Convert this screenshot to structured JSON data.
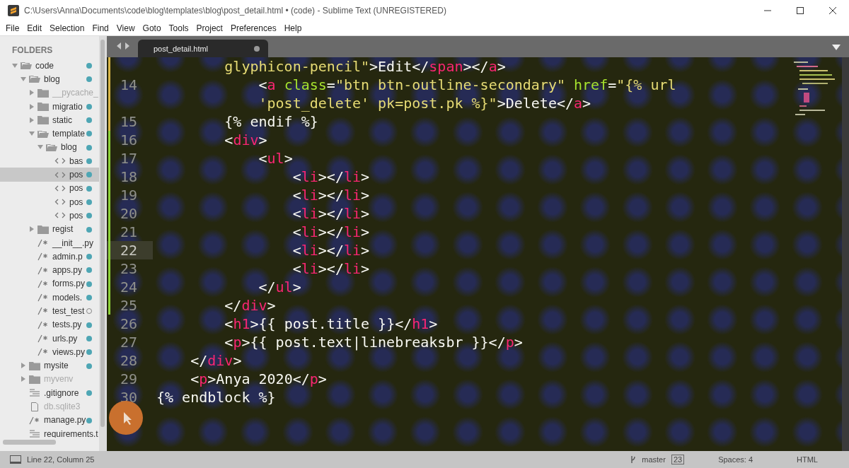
{
  "window": {
    "title": "C:\\Users\\Anna\\Documents\\code\\blog\\templates\\blog\\post_detail.html • (code) - Sublime Text (UNREGISTERED)"
  },
  "menu": [
    "File",
    "Edit",
    "Selection",
    "Find",
    "View",
    "Goto",
    "Tools",
    "Project",
    "Preferences",
    "Help"
  ],
  "sidebar": {
    "header": "FOLDERS",
    "tree": [
      {
        "name": "code",
        "kind": "folder",
        "expanded": true,
        "changed": true,
        "untracked": false,
        "ignored": false,
        "selected": false,
        "children": [
          {
            "name": "blog",
            "kind": "folder",
            "expanded": true,
            "changed": true,
            "untracked": false,
            "ignored": false,
            "selected": false,
            "children": [
              {
                "name": "__pycache_",
                "kind": "folder",
                "expanded": false,
                "changed": false,
                "untracked": false,
                "ignored": true,
                "selected": false
              },
              {
                "name": "migratio",
                "kind": "folder",
                "expanded": false,
                "changed": true,
                "untracked": false,
                "ignored": false,
                "selected": false
              },
              {
                "name": "static",
                "kind": "folder",
                "expanded": false,
                "changed": true,
                "untracked": false,
                "ignored": false,
                "selected": false
              },
              {
                "name": "template",
                "kind": "folder",
                "expanded": true,
                "changed": true,
                "untracked": false,
                "ignored": false,
                "selected": false,
                "children": [
                  {
                    "name": "blog",
                    "kind": "folder",
                    "expanded": true,
                    "changed": true,
                    "untracked": false,
                    "ignored": false,
                    "selected": false,
                    "children": [
                      {
                        "name": "bas",
                        "kind": "html",
                        "changed": true,
                        "untracked": false,
                        "ignored": false,
                        "selected": false
                      },
                      {
                        "name": "pos",
                        "kind": "html",
                        "changed": true,
                        "untracked": false,
                        "ignored": false,
                        "selected": true
                      },
                      {
                        "name": "pos",
                        "kind": "html",
                        "changed": true,
                        "untracked": false,
                        "ignored": false,
                        "selected": false
                      },
                      {
                        "name": "pos",
                        "kind": "html",
                        "changed": true,
                        "untracked": false,
                        "ignored": false,
                        "selected": false
                      },
                      {
                        "name": "pos",
                        "kind": "html",
                        "changed": true,
                        "untracked": false,
                        "ignored": false,
                        "selected": false
                      }
                    ]
                  }
                ]
              },
              {
                "name": "regist",
                "kind": "folder",
                "expanded": false,
                "changed": true,
                "untracked": false,
                "ignored": false,
                "selected": false
              },
              {
                "name": "__init__.py",
                "kind": "python",
                "changed": false,
                "untracked": false,
                "ignored": false,
                "selected": false
              },
              {
                "name": "admin.p",
                "kind": "python",
                "changed": true,
                "untracked": false,
                "ignored": false,
                "selected": false
              },
              {
                "name": "apps.py",
                "kind": "python",
                "changed": true,
                "untracked": false,
                "ignored": false,
                "selected": false
              },
              {
                "name": "forms.py",
                "kind": "python",
                "changed": true,
                "untracked": false,
                "ignored": false,
                "selected": false
              },
              {
                "name": "models.",
                "kind": "python",
                "changed": true,
                "untracked": false,
                "ignored": false,
                "selected": false
              },
              {
                "name": "test_test",
                "kind": "python",
                "changed": false,
                "untracked": true,
                "ignored": false,
                "selected": false
              },
              {
                "name": "tests.py",
                "kind": "python",
                "changed": true,
                "untracked": false,
                "ignored": false,
                "selected": false
              },
              {
                "name": "urls.py",
                "kind": "python",
                "changed": true,
                "untracked": false,
                "ignored": false,
                "selected": false
              },
              {
                "name": "views.py",
                "kind": "python",
                "changed": true,
                "untracked": false,
                "ignored": false,
                "selected": false
              }
            ]
          },
          {
            "name": "mysite",
            "kind": "folder",
            "expanded": false,
            "changed": true,
            "untracked": false,
            "ignored": false,
            "selected": false
          },
          {
            "name": "myvenv",
            "kind": "folder",
            "expanded": false,
            "changed": false,
            "untracked": false,
            "ignored": true,
            "selected": false
          },
          {
            "name": ".gitignore",
            "kind": "text",
            "changed": true,
            "untracked": false,
            "ignored": false,
            "selected": false
          },
          {
            "name": "db.sqlite3",
            "kind": "blank",
            "changed": false,
            "untracked": false,
            "ignored": true,
            "selected": false
          },
          {
            "name": "manage.py",
            "kind": "python",
            "changed": true,
            "untracked": false,
            "ignored": false,
            "selected": false
          },
          {
            "name": "requirements.t",
            "kind": "text",
            "changed": false,
            "untracked": false,
            "ignored": false,
            "selected": false
          }
        ]
      }
    ]
  },
  "tab": {
    "label": "post_detail.html",
    "dirty": true
  },
  "code": {
    "lines": [
      {
        "color": "#d9b648",
        "current": false,
        "tokens": [
          {
            "kind": "string",
            "text": "        glyphicon-pencil\""
          },
          {
            "kind": "punct",
            "text": ">Edit</"
          },
          {
            "kind": "tag",
            "text": "span"
          },
          {
            "kind": "punct",
            "text": "></"
          },
          {
            "kind": "tag",
            "text": "a"
          },
          {
            "kind": "punct",
            "text": ">"
          }
        ]
      },
      {
        "number": "14",
        "color": "#d9b648",
        "current": false,
        "tokens": [
          {
            "kind": "punct",
            "text": "            <"
          },
          {
            "kind": "tag",
            "text": "a"
          },
          {
            "kind": "attr",
            "text": " class"
          },
          {
            "kind": "punct",
            "text": "="
          },
          {
            "kind": "string",
            "text": "\"btn btn-outline-secondary\""
          },
          {
            "kind": "attr",
            "text": " href"
          },
          {
            "kind": "punct",
            "text": "="
          },
          {
            "kind": "string",
            "text": "\"{% url"
          }
        ]
      },
      {
        "color": "#d9b648",
        "current": false,
        "tokens": [
          {
            "kind": "string",
            "text": "            'post_delete' pk=post.pk %}\""
          },
          {
            "kind": "punct",
            "text": ">Delete</"
          },
          {
            "kind": "tag",
            "text": "a"
          },
          {
            "kind": "punct",
            "text": ">"
          }
        ]
      },
      {
        "number": "15",
        "color": "#d9b648",
        "current": false,
        "tokens": [
          {
            "kind": "text",
            "text": "        {% endif %}"
          }
        ]
      },
      {
        "number": "16",
        "color": "#8fd43a",
        "current": false,
        "tokens": [
          {
            "kind": "punct",
            "text": "        <"
          },
          {
            "kind": "tag",
            "text": "div"
          },
          {
            "kind": "punct",
            "text": ">"
          }
        ]
      },
      {
        "number": "17",
        "color": "#8fd43a",
        "current": false,
        "tokens": [
          {
            "kind": "punct",
            "text": "            <"
          },
          {
            "kind": "tag",
            "text": "ul"
          },
          {
            "kind": "punct",
            "text": ">"
          }
        ]
      },
      {
        "number": "18",
        "color": "#8fd43a",
        "current": false,
        "tokens": [
          {
            "kind": "punct",
            "text": "                <"
          },
          {
            "kind": "tag",
            "text": "li"
          },
          {
            "kind": "punct",
            "text": "></"
          },
          {
            "kind": "tag",
            "text": "li"
          },
          {
            "kind": "punct",
            "text": ">"
          }
        ]
      },
      {
        "number": "19",
        "color": "#8fd43a",
        "current": false,
        "tokens": [
          {
            "kind": "punct",
            "text": "                <"
          },
          {
            "kind": "tag",
            "text": "li"
          },
          {
            "kind": "punct",
            "text": "></"
          },
          {
            "kind": "tag",
            "text": "li"
          },
          {
            "kind": "punct",
            "text": ">"
          }
        ]
      },
      {
        "number": "20",
        "color": "#8fd43a",
        "current": false,
        "tokens": [
          {
            "kind": "punct",
            "text": "                <"
          },
          {
            "kind": "tag",
            "text": "li"
          },
          {
            "kind": "punct",
            "text": "></"
          },
          {
            "kind": "tag",
            "text": "li"
          },
          {
            "kind": "punct",
            "text": ">"
          }
        ]
      },
      {
        "number": "21",
        "color": "#8fd43a",
        "current": false,
        "tokens": [
          {
            "kind": "punct",
            "text": "                <"
          },
          {
            "kind": "tag",
            "text": "li"
          },
          {
            "kind": "punct",
            "text": "></"
          },
          {
            "kind": "tag",
            "text": "li"
          },
          {
            "kind": "punct",
            "text": ">"
          }
        ]
      },
      {
        "number": "22",
        "color": "#8fd43a",
        "current": true,
        "tokens": [
          {
            "kind": "punct",
            "text": "                <"
          },
          {
            "kind": "tag",
            "text": "li"
          },
          {
            "kind": "punct",
            "text": "></"
          },
          {
            "kind": "tag",
            "text": "li"
          },
          {
            "kind": "punct",
            "text": ">"
          }
        ]
      },
      {
        "number": "23",
        "color": "#8fd43a",
        "current": false,
        "tokens": [
          {
            "kind": "punct",
            "text": "                <"
          },
          {
            "kind": "tag",
            "text": "li"
          },
          {
            "kind": "punct",
            "text": "></"
          },
          {
            "kind": "tag",
            "text": "li"
          },
          {
            "kind": "punct",
            "text": ">"
          }
        ]
      },
      {
        "number": "24",
        "color": "#8fd43a",
        "current": false,
        "tokens": [
          {
            "kind": "punct",
            "text": "            </"
          },
          {
            "kind": "tag",
            "text": "ul"
          },
          {
            "kind": "punct",
            "text": ">"
          }
        ]
      },
      {
        "number": "25",
        "color": "#8fd43a",
        "current": false,
        "tokens": [
          {
            "kind": "punct",
            "text": "        </"
          },
          {
            "kind": "tag",
            "text": "div"
          },
          {
            "kind": "punct",
            "text": ">"
          }
        ]
      },
      {
        "number": "26",
        "current": false,
        "tokens": [
          {
            "kind": "punct",
            "text": "        <"
          },
          {
            "kind": "tag",
            "text": "h1"
          },
          {
            "kind": "punct",
            "text": ">{{ post.title }}</"
          },
          {
            "kind": "tag",
            "text": "h1"
          },
          {
            "kind": "punct",
            "text": ">"
          }
        ]
      },
      {
        "number": "27",
        "current": false,
        "tokens": [
          {
            "kind": "punct",
            "text": "        <"
          },
          {
            "kind": "tag",
            "text": "p"
          },
          {
            "kind": "punct",
            "text": ">{{ post.text|linebreaksbr }}</"
          },
          {
            "kind": "tag",
            "text": "p"
          },
          {
            "kind": "punct",
            "text": ">"
          }
        ]
      },
      {
        "number": "28",
        "current": false,
        "tokens": [
          {
            "kind": "punct",
            "text": "    </"
          },
          {
            "kind": "tag",
            "text": "div"
          },
          {
            "kind": "punct",
            "text": ">"
          }
        ]
      },
      {
        "number": "29",
        "current": false,
        "tokens": [
          {
            "kind": "punct",
            "text": "    <"
          },
          {
            "kind": "tag",
            "text": "p"
          },
          {
            "kind": "punct",
            "text": ">Anya 2020</"
          },
          {
            "kind": "tag",
            "text": "p"
          },
          {
            "kind": "punct",
            "text": ">"
          }
        ]
      },
      {
        "number": "30",
        "current": false,
        "tokens": [
          {
            "kind": "text",
            "text": "{% endblock %}"
          }
        ]
      }
    ]
  },
  "status_bar": {
    "position": "Line 22, Column 25",
    "branch": "master",
    "changes": "23",
    "indentation": "Spaces: 4",
    "syntax": "HTML"
  }
}
